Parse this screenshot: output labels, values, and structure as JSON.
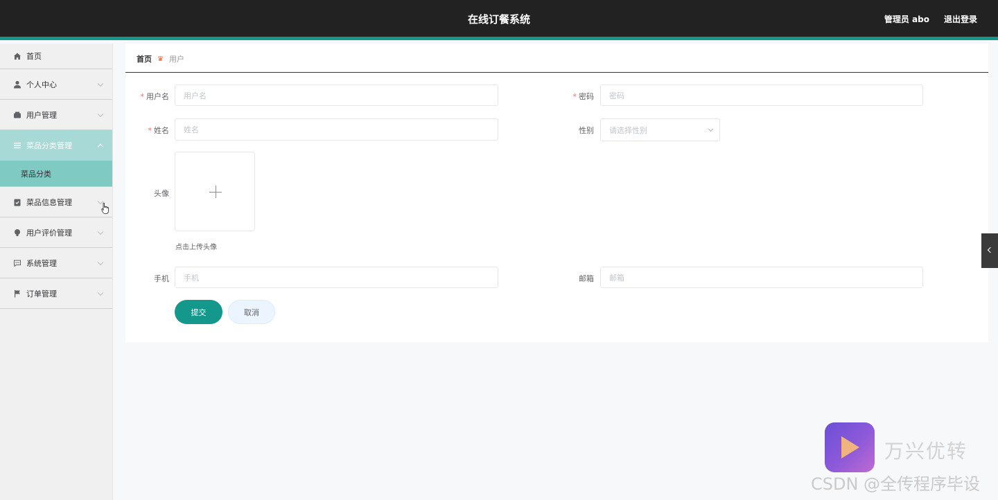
{
  "header": {
    "title": "在线订餐系统",
    "user": "管理员 abo",
    "logout": "退出登录"
  },
  "sidebar": {
    "items": [
      {
        "label": "首页",
        "icon": "home-icon"
      },
      {
        "label": "个人中心",
        "icon": "user-icon"
      },
      {
        "label": "用户管理",
        "icon": "wallet-icon"
      },
      {
        "label": "菜品分类管理",
        "icon": "list-icon",
        "expanded": true
      },
      {
        "label": "菜品信息管理",
        "icon": "clipboard-check-icon"
      },
      {
        "label": "用户评价管理",
        "icon": "bulb-icon"
      },
      {
        "label": "系统管理",
        "icon": "chat-icon"
      },
      {
        "label": "订单管理",
        "icon": "flag-icon"
      }
    ],
    "submenu": {
      "label": "菜品分类"
    }
  },
  "breadcrumb": {
    "home": "首页",
    "current": "用户"
  },
  "form": {
    "username": {
      "label": "用户名",
      "placeholder": "用户名"
    },
    "password": {
      "label": "密码",
      "placeholder": "密码"
    },
    "name": {
      "label": "姓名",
      "placeholder": "姓名"
    },
    "gender": {
      "label": "性别",
      "placeholder": "请选择性别"
    },
    "avatar": {
      "label": "头像",
      "hint": "点击上传头像"
    },
    "phone": {
      "label": "手机",
      "placeholder": "手机"
    },
    "email": {
      "label": "邮箱",
      "placeholder": "邮箱"
    },
    "submit": "提交",
    "cancel": "取消"
  },
  "watermark": {
    "brand": "万兴优转",
    "csdn": "CSDN @全传程序毕设"
  },
  "colors": {
    "accent": "#13988b",
    "topbar": "#222222",
    "active_menu": "#a7dad6",
    "submenu": "#7fcac3"
  }
}
